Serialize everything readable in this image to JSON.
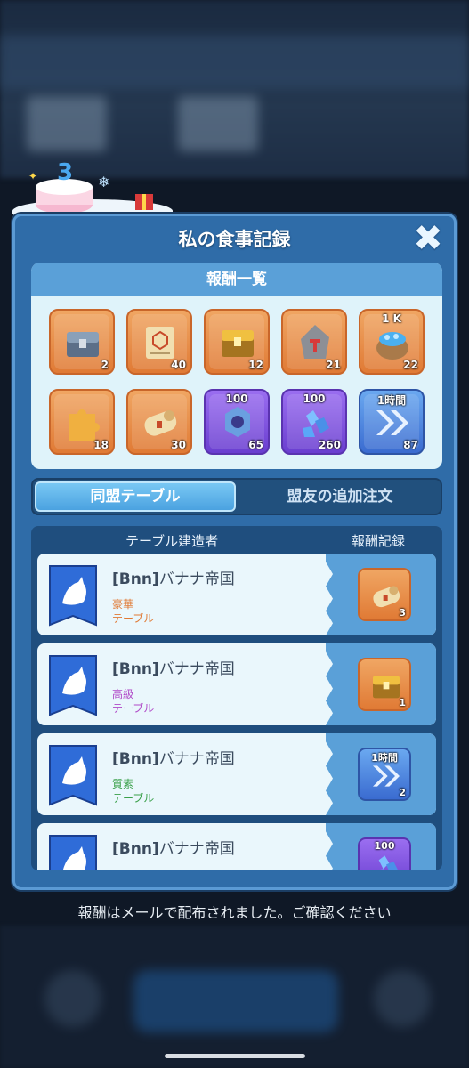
{
  "panel": {
    "title": "私の食事記録",
    "close_icon": "close-icon"
  },
  "rewards": {
    "header": "報酬一覧",
    "items": [
      {
        "icon": "silver-chest-icon",
        "count": "2",
        "top": "",
        "color": "orange"
      },
      {
        "icon": "scroll-icon",
        "count": "40",
        "top": "",
        "color": "orange"
      },
      {
        "icon": "gold-chest-icon",
        "count": "12",
        "top": "",
        "color": "orange"
      },
      {
        "icon": "ore-stone-icon",
        "count": "21",
        "top": "",
        "color": "orange"
      },
      {
        "icon": "gem-pot-icon",
        "count": "22",
        "top": "1 K",
        "color": "orange"
      },
      {
        "icon": "puzzle-piece-icon",
        "count": "18",
        "top": "",
        "color": "orange"
      },
      {
        "icon": "rolled-scroll-icon",
        "count": "30",
        "top": "",
        "color": "orange"
      },
      {
        "icon": "gear-icon",
        "count": "65",
        "top": "100",
        "color": "purple"
      },
      {
        "icon": "crystal-icon",
        "count": "260",
        "top": "100",
        "color": "purple"
      },
      {
        "icon": "speedup-icon",
        "count": "87",
        "top": "1時間",
        "color": "blue"
      }
    ]
  },
  "tabs": {
    "active": "同盟テーブル",
    "inactive": "盟友の追加注文"
  },
  "list": {
    "col_builder": "テーブル建造者",
    "col_reward": "報酬記録",
    "rows": [
      {
        "tag": "[Bnn]",
        "name": "バナナ帝国",
        "grade": "豪華",
        "grade_color": "#e07a35",
        "table": "テーブル",
        "table_color": "#e07a35",
        "reward_icon": "rolled-scroll-icon",
        "reward_count": "3",
        "reward_top": "",
        "reward_color": "orange"
      },
      {
        "tag": "[Bnn]",
        "name": "バナナ帝国",
        "grade": "高級",
        "grade_color": "#b04ac8",
        "table": "テーブル",
        "table_color": "#b04ac8",
        "reward_icon": "gold-chest-icon",
        "reward_count": "1",
        "reward_top": "",
        "reward_color": "orange"
      },
      {
        "tag": "[Bnn]",
        "name": "バナナ帝国",
        "grade": "質素",
        "grade_color": "#3aa04a",
        "table": "テーブル",
        "table_color": "#3aa04a",
        "reward_icon": "speedup-icon",
        "reward_count": "2",
        "reward_top": "1時間",
        "reward_color": "blue"
      },
      {
        "tag": "[Bnn]",
        "name": "バナナ帝国",
        "grade": "",
        "grade_color": "#3aa04a",
        "table": "",
        "table_color": "#3aa04a",
        "reward_icon": "crystal-icon",
        "reward_count": "",
        "reward_top": "100",
        "reward_color": "purple"
      }
    ]
  },
  "footer": {
    "message": "報酬はメールで配布されました。ご確認ください"
  }
}
